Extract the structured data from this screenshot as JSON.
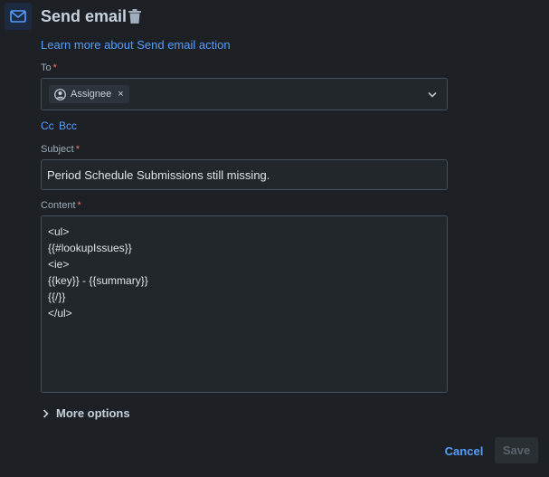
{
  "header": {
    "title": "Send email",
    "icon": "mail-icon",
    "delete_icon": "trash-icon",
    "learn_more_link": "Learn more about Send email action"
  },
  "form": {
    "to": {
      "label": "To",
      "required_mark": "*",
      "chips": [
        {
          "label": "Assignee",
          "icon": "user-avatar-icon",
          "remove": "×"
        }
      ]
    },
    "cc_label": "Cc",
    "bcc_label": "Bcc",
    "subject": {
      "label": "Subject",
      "required_mark": "*",
      "value": "Period Schedule Submissions still missing."
    },
    "content": {
      "label": "Content",
      "required_mark": "*",
      "lines": [
        "<ul>",
        "{{#lookupIssues}}",
        "<ie>",
        "{{key}} - {{summary}}",
        "{{/}}",
        "</ul>"
      ]
    },
    "more_options_label": "More options"
  },
  "footer": {
    "cancel_label": "Cancel",
    "save_label": "Save"
  },
  "colors": {
    "background": "#1d2125",
    "link": "#579dff",
    "required": "#f87168",
    "icon_box": "#1c2b41"
  }
}
